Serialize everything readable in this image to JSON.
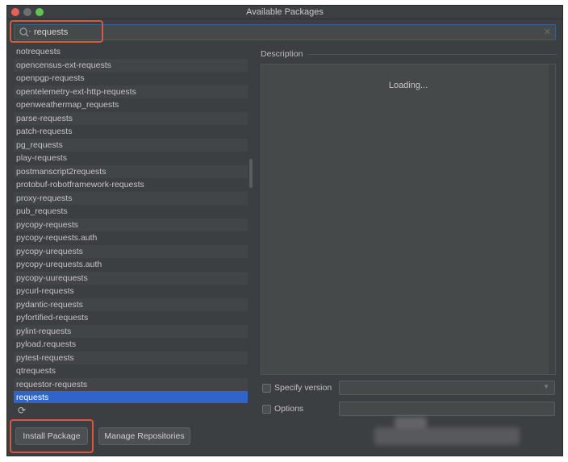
{
  "window": {
    "title": "Available Packages"
  },
  "search": {
    "value": "requests"
  },
  "packages": [
    "notrequests",
    "opencensus-ext-requests",
    "openpgp-requests",
    "opentelemetry-ext-http-requests",
    "openweathermap_requests",
    "parse-requests",
    "patch-requests",
    "pg_requests",
    "play-requests",
    "postmanscript2requests",
    "protobuf-robotframework-requests",
    "proxy-requests",
    "pub_requests",
    "pycopy-requests",
    "pycopy-requests.auth",
    "pycopy-urequests",
    "pycopy-urequests.auth",
    "pycopy-uurequests",
    "pycurl-requests",
    "pydantic-requests",
    "pyfortified-requests",
    "pylint-requests",
    "pyload.requests",
    "pytest-requests",
    "qtrequests",
    "requestor-requests",
    "requests"
  ],
  "selected_package": "requests",
  "description": {
    "label": "Description",
    "status": "Loading..."
  },
  "options": {
    "specify_version_label": "Specify version",
    "options_label": "Options"
  },
  "buttons": {
    "install": "Install Package",
    "manage_repos": "Manage Repositories"
  },
  "colors": {
    "selection": "#2f65ca",
    "callout": "#d9573a",
    "background": "#3c3f41"
  },
  "icons": {
    "search": "search-icon",
    "clear": "clear-icon",
    "refresh": "refresh-icon"
  }
}
